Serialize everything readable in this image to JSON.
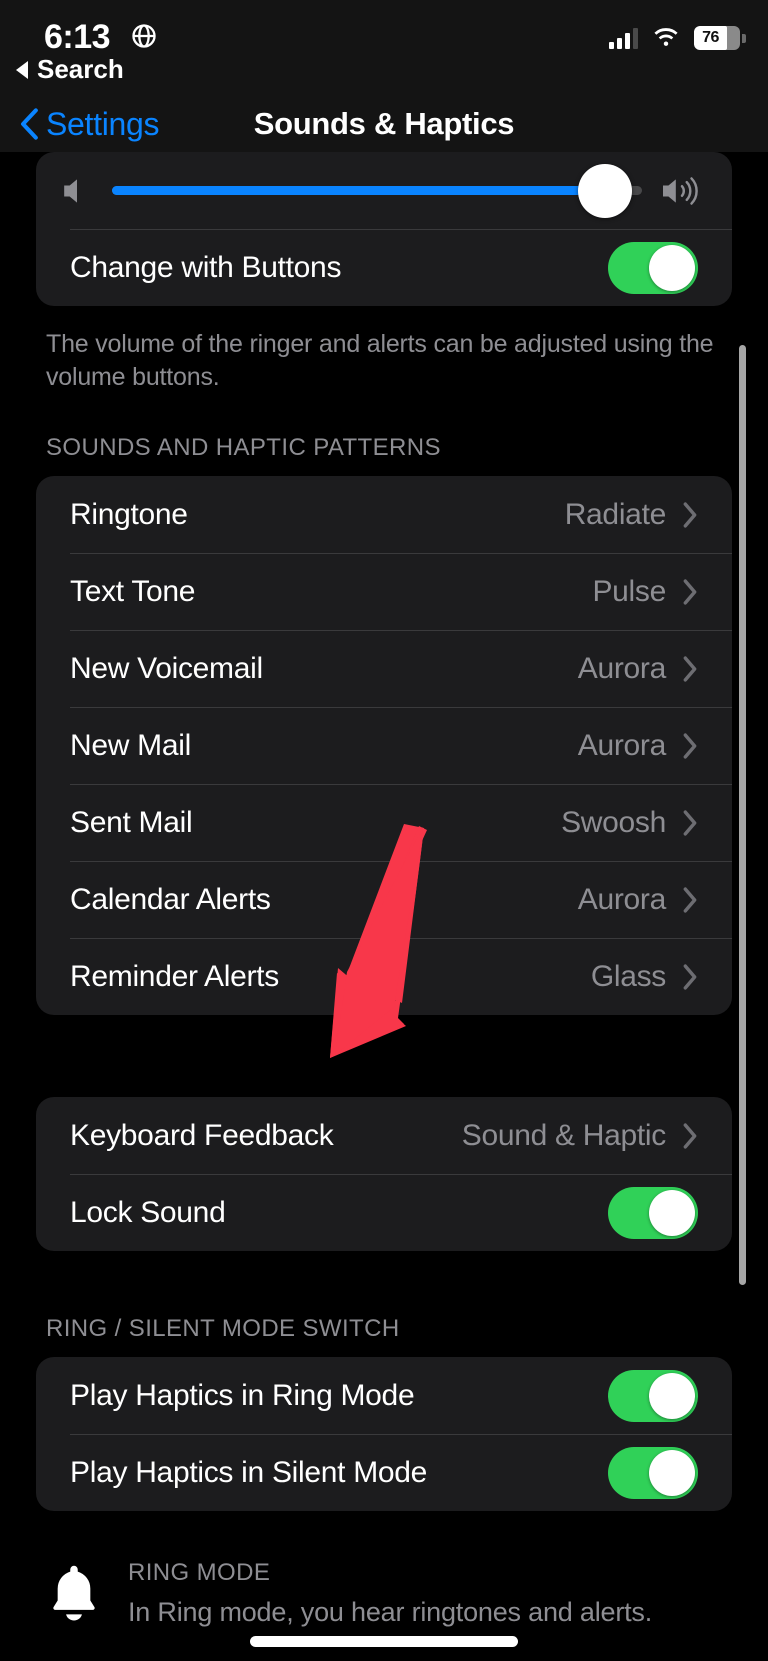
{
  "status_bar": {
    "time": "6:13",
    "location_icon": "globe-icon",
    "cellular_icon": "cellular-bars-icon",
    "wifi_icon": "wifi-icon",
    "battery_percent": "76"
  },
  "back_chip": {
    "label": "Search",
    "icon": "back-triangle-icon"
  },
  "nav_bar": {
    "back_label": "Settings",
    "title": "Sounds & Haptics",
    "accent_color": "#0a84ff"
  },
  "volume": {
    "min_icon": "speaker-off-icon",
    "max_icon": "speaker-wave-icon",
    "value_percent": "93"
  },
  "change_with_buttons": {
    "label": "Change with Buttons",
    "enabled": true
  },
  "volume_footnote": "The volume of the ringer and alerts can be adjusted using the volume buttons.",
  "sounds_section": {
    "header": "SOUNDS AND HAPTIC PATTERNS",
    "rows": [
      {
        "label": "Ringtone",
        "value": "Radiate"
      },
      {
        "label": "Text Tone",
        "value": "Pulse"
      },
      {
        "label": "New Voicemail",
        "value": "Aurora"
      },
      {
        "label": "New Mail",
        "value": "Aurora"
      },
      {
        "label": "Sent Mail",
        "value": "Swoosh"
      },
      {
        "label": "Calendar Alerts",
        "value": "Aurora"
      },
      {
        "label": "Reminder Alerts",
        "value": "Glass"
      }
    ]
  },
  "keyboard_section": {
    "keyboard_feedback": {
      "label": "Keyboard Feedback",
      "value": "Sound & Haptic"
    },
    "lock_sound": {
      "label": "Lock Sound",
      "enabled": true
    }
  },
  "ring_silent_section": {
    "header": "RING / SILENT MODE SWITCH",
    "rows": [
      {
        "label": "Play Haptics in Ring Mode",
        "enabled": true
      },
      {
        "label": "Play Haptics in Silent Mode",
        "enabled": true
      }
    ]
  },
  "ring_mode_info": {
    "icon": "bell-icon",
    "title": "RING MODE",
    "body": "In Ring mode, you hear ringtones and alerts."
  },
  "annotation": {
    "type": "arrow",
    "color": "#f8374a",
    "points_at": "Keyboard Feedback"
  },
  "colors": {
    "background": "#000000",
    "group_background": "#1c1c1e",
    "separator": "#3a3a3c",
    "secondary_text": "#8e8e93",
    "toggle_on": "#30d158",
    "accent_blue": "#0a84ff"
  }
}
